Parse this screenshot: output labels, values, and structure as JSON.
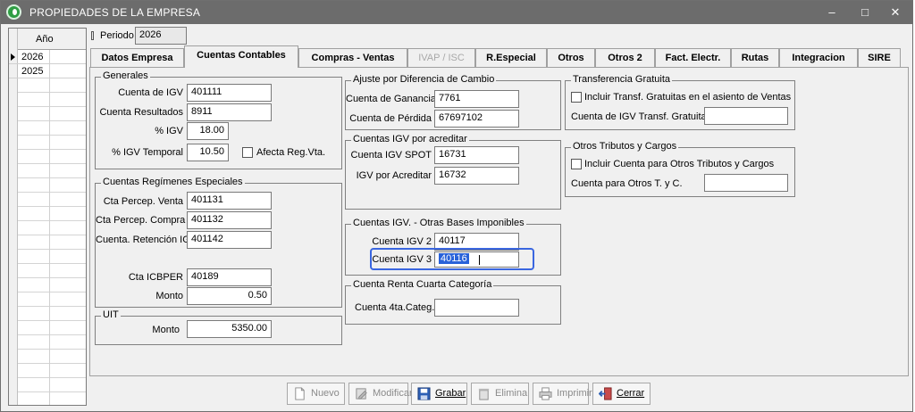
{
  "window": {
    "title": "PROPIEDADES DE LA EMPRESA"
  },
  "yeargrid": {
    "header": "Año",
    "rows": [
      "2026",
      "2025"
    ]
  },
  "period": {
    "label": "Periodo",
    "value": "2026"
  },
  "tabs": [
    {
      "label": "Datos Empresa"
    },
    {
      "label": "Cuentas Contables"
    },
    {
      "label": "Compras - Ventas"
    },
    {
      "label": "IVAP / ISC"
    },
    {
      "label": "R.Especial"
    },
    {
      "label": "Otros"
    },
    {
      "label": "Otros 2"
    },
    {
      "label": "Fact. Electr."
    },
    {
      "label": "Rutas"
    },
    {
      "label": "Integracion"
    },
    {
      "label": "SIRE"
    }
  ],
  "generales": {
    "title": "Generales",
    "cuenta_igv_label": "Cuenta de IGV",
    "cuenta_igv": "401111",
    "cuenta_resultados_label": "Cuenta Resultados",
    "cuenta_resultados": "8911",
    "pct_igv_label": "% IGV",
    "pct_igv": "18.00",
    "pct_igv_temporal_label": "% IGV Temporal",
    "pct_igv_temporal": "10.50",
    "afecta_label": "Afecta Reg.Vta."
  },
  "regimenes": {
    "title": "Cuentas Regímenes Especiales",
    "percep_venta_label": "Cta Percep. Venta",
    "percep_venta": "401131",
    "percep_compra_label": "Cta Percep. Compra",
    "percep_compra": "401132",
    "retencion_label": "Cuenta. Retención IGV",
    "retencion": "401142",
    "icbper_label": "Cta ICBPER",
    "icbper": "40189",
    "monto_label": "Monto",
    "monto": "0.50"
  },
  "uit": {
    "title": "UIT",
    "monto_label": "Monto",
    "monto": "5350.00"
  },
  "ajuste": {
    "title": "Ajuste por Diferencia de Cambio",
    "ganancia_label": "Cuenta de Ganancia",
    "ganancia": "7761",
    "perdida_label": "Cuenta de Pérdida",
    "perdida": "67697102"
  },
  "por_acreditar": {
    "title": "Cuentas IGV por acreditar",
    "spot_label": "Cuenta IGV SPOT",
    "spot": "16731",
    "acreditar_label": "IGV por Acreditar",
    "acreditar": "16732"
  },
  "otras_bases": {
    "title": "Cuentas IGV. - Otras Bases Imponibles",
    "igv2_label": "Cuenta IGV 2",
    "igv2": "40117",
    "igv3_label": "Cuenta IGV 3",
    "igv3": "40116"
  },
  "renta": {
    "title": "Cuenta Renta Cuarta Categoría",
    "cuarta_label": "Cuenta 4ta.Categ.:",
    "cuarta": ""
  },
  "transferencia": {
    "title": "Transferencia Gratuita",
    "incluir_label": "Incluir Transf. Gratuitas en el asiento de Ventas",
    "cuenta_label": "Cuenta de IGV Transf. Gratuita",
    "cuenta": ""
  },
  "otros_tributos": {
    "title": "Otros Tributos y Cargos",
    "incluir_label": "Incluir Cuenta para Otros Tributos y Cargos",
    "cuenta_label": "Cuenta para Otros T. y C.",
    "cuenta": ""
  },
  "buttons": {
    "nuevo": "Nuevo",
    "modificar": "Modificar",
    "grabar": "Grabar",
    "elimina": "Elimina",
    "imprimir": "Imprimir",
    "cerrar": "Cerrar"
  },
  "icons": {
    "app": "app-logo-icon",
    "minimize": "minimize-icon",
    "maximize": "maximize-icon",
    "close": "close-icon"
  },
  "colors": {
    "focus": "#3a66e0",
    "selection": "#2962d9",
    "titlebar": "#6c6c6c"
  }
}
